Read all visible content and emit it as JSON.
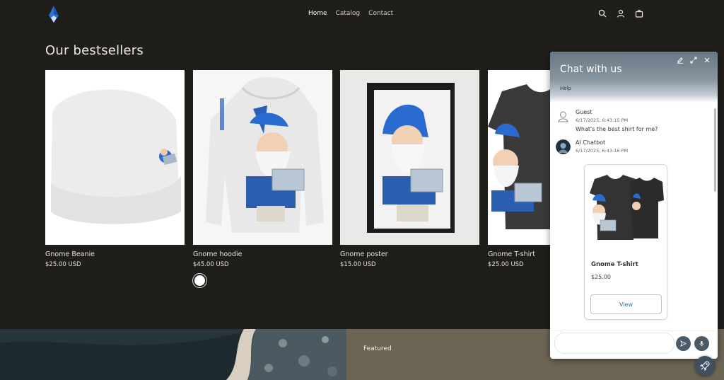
{
  "header": {
    "logo_icon": "diamond-logo-icon",
    "nav": [
      {
        "label": "Home",
        "active": true
      },
      {
        "label": "Catalog",
        "active": false
      },
      {
        "label": "Contact",
        "active": false
      }
    ],
    "icons": [
      "search-icon",
      "account-icon",
      "cart-icon"
    ]
  },
  "section": {
    "title": "Our bestsellers"
  },
  "products": [
    {
      "name": "Gnome Beanie",
      "price": "$25.00 USD"
    },
    {
      "name": "Gnome hoodie",
      "price": "$45.00 USD",
      "swatch_color": "#ffffff"
    },
    {
      "name": "Gnome poster",
      "price": "$15.00 USD"
    },
    {
      "name": "Gnome T-shirt",
      "price": "$25.00 USD"
    }
  ],
  "banner": {
    "label": "Featured"
  },
  "chat": {
    "title": "Chat with us",
    "subtitle": "Help",
    "messages": [
      {
        "author": "Guest",
        "time": "6/17/2025, 6:43:15 PM",
        "text": "What's the best shirt for me?"
      },
      {
        "author": "AI Chatbot",
        "time": "6/17/2025, 6:43:16 PM"
      }
    ],
    "product_card": {
      "name": "Gnome T-shirt",
      "price": "$25.00",
      "button": "View"
    },
    "input_placeholder": ""
  },
  "colors": {
    "page_bg": "#1f1e1a",
    "chat_header": "#687784",
    "accent_blue": "#2f6fd6"
  }
}
